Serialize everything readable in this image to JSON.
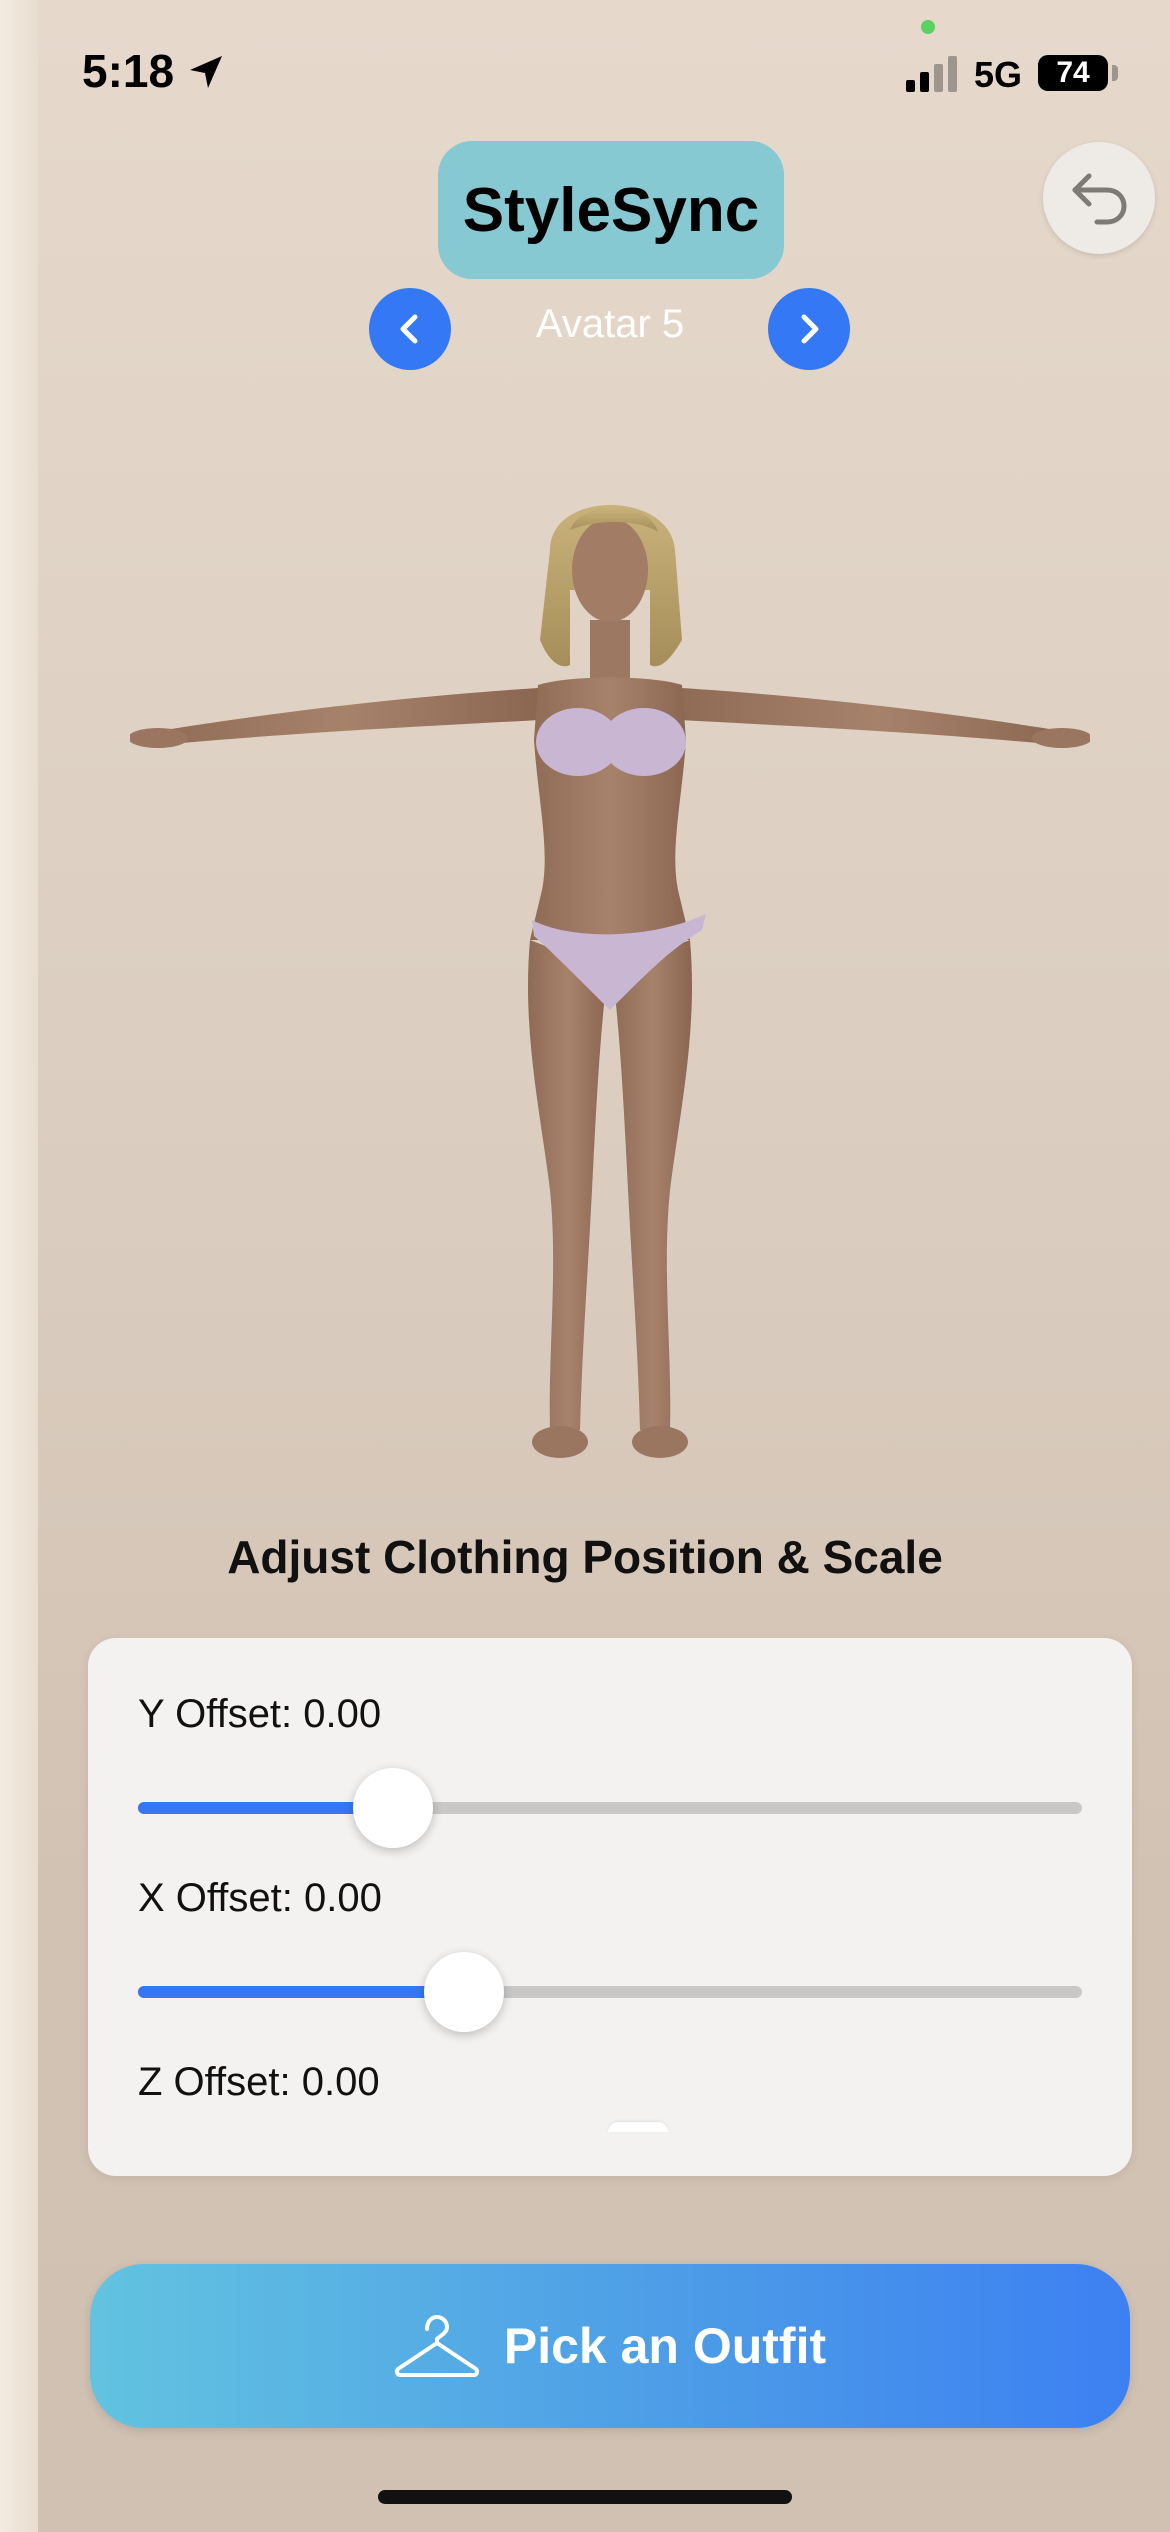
{
  "status_bar": {
    "time": "5:18",
    "network": "5G",
    "battery_level": "74"
  },
  "header": {
    "app_title": "StyleSync",
    "avatar_name": "Avatar 5"
  },
  "adjust": {
    "title": "Adjust Clothing Position & Scale",
    "sliders": [
      {
        "label": "Y Offset: 0.00",
        "fraction": 0.27
      },
      {
        "label": "X Offset: 0.00",
        "fraction": 0.345
      },
      {
        "label": "Z Offset: 0.00"
      }
    ]
  },
  "actions": {
    "pick_outfit_label": "Pick an Outfit"
  },
  "colors": {
    "accent_blue": "#3478f6",
    "title_teal": "#86c9d3",
    "outfit_lavender": "#c9b6d2"
  },
  "icons": {
    "location": "location-arrow-icon",
    "undo": "undo-icon",
    "prev": "chevron-left-icon",
    "next": "chevron-right-icon",
    "hanger": "hanger-icon"
  }
}
